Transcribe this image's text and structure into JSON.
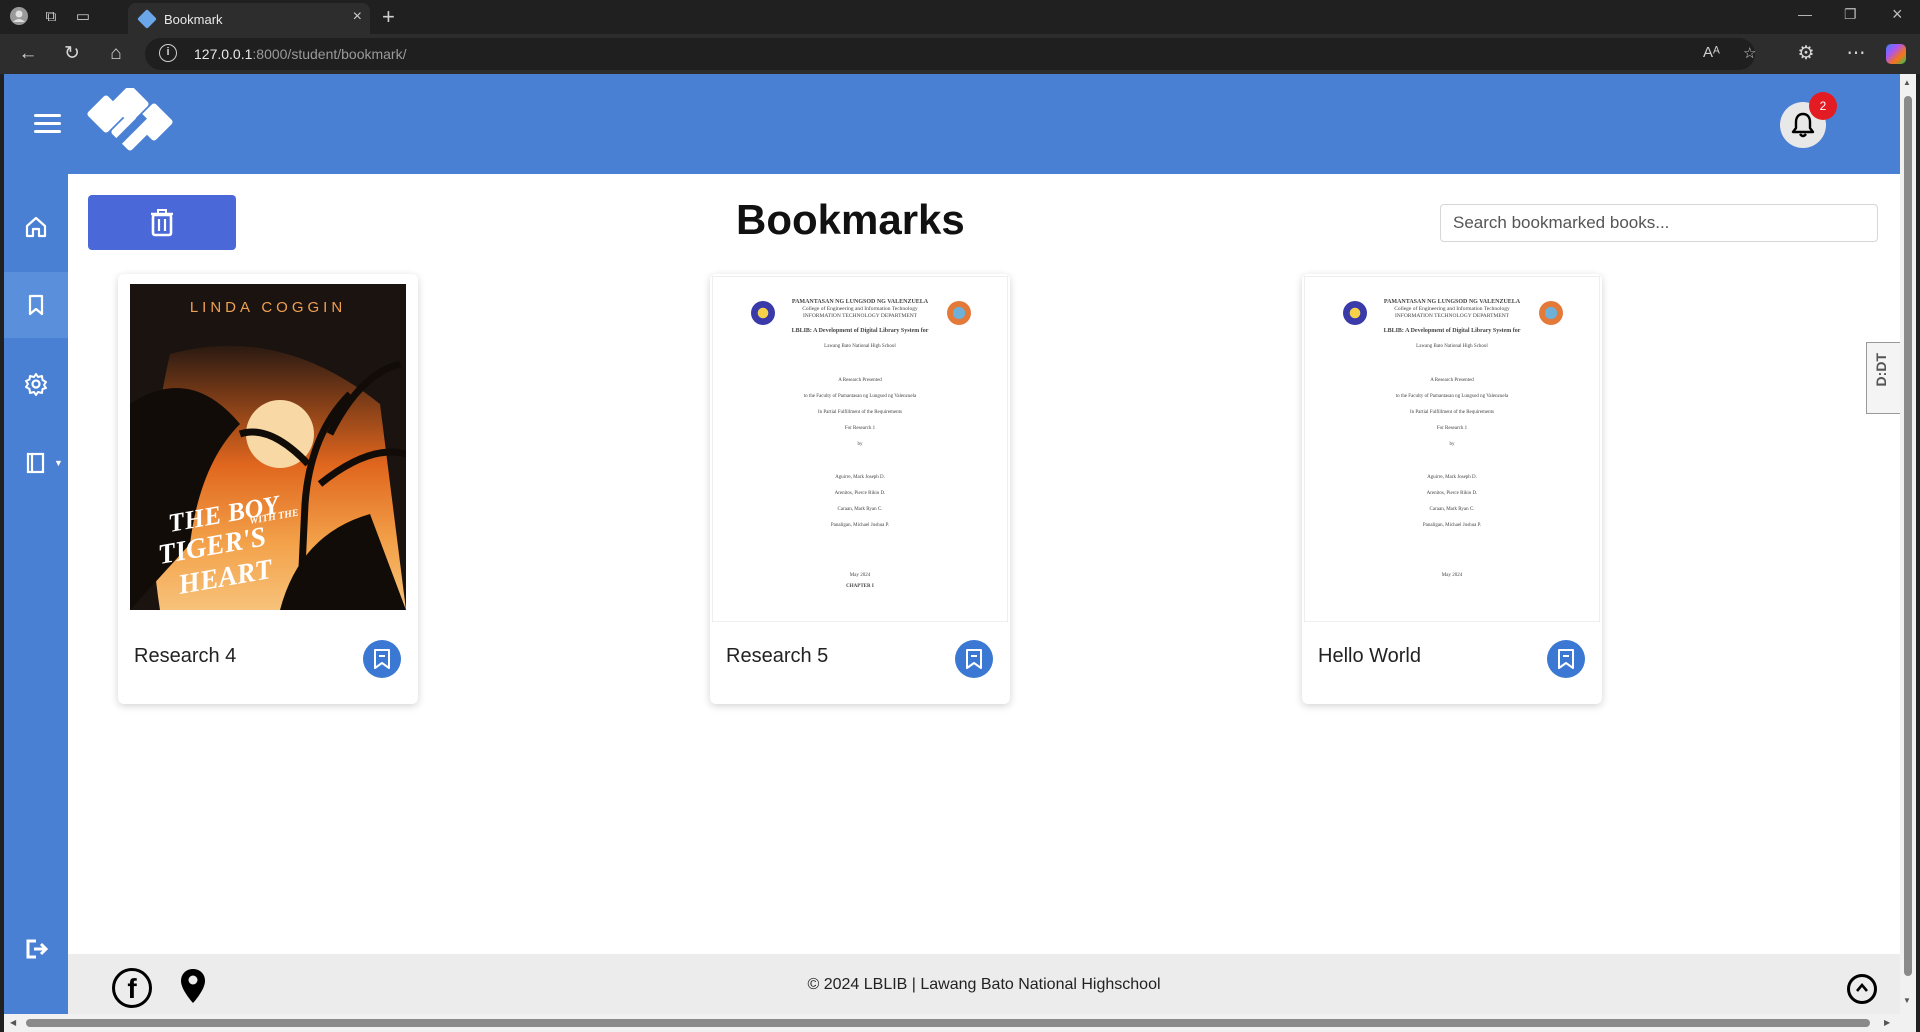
{
  "browser": {
    "tab_title": "Bookmark",
    "url_host": "127.0.0.1",
    "url_path": ":8000/student/bookmark/"
  },
  "header": {
    "notification_count": "2"
  },
  "page": {
    "title": "Bookmarks",
    "search_placeholder": "Search bookmarked books..."
  },
  "cards": [
    {
      "label": "Research 4",
      "cover_author": "LINDA COGGIN",
      "cover_title_lines": [
        "THE BOY",
        "WITH THE",
        "TIGER'S",
        "HEART"
      ]
    },
    {
      "label": "Research 5",
      "doc": {
        "header1": "PAMANTASAN NG LUNGSOD NG VALENZUELA",
        "header2": "College of Engineering and Information Technology",
        "header3": "INFORMATION TECHNOLOGY DEPARTMENT",
        "title": "LBLIB: A Development of Digital Library System for",
        "school": "Lawang Bato National High School",
        "lines": [
          "A Research Presented",
          "to the Faculty of Pamantasan ng Lungsod ng Valenzuela",
          "In Partial Fulfillment of the Requirements",
          "For Research 1",
          "by"
        ],
        "authors": [
          "Aguirre, Mark Joseph D.",
          "Arenitos, Pierce Rikio D.",
          "Caraan, Mark Ryan C.",
          "Panaligan, Michael Joshua P."
        ],
        "date": "May 2024",
        "chapter": "CHAPTER I"
      }
    },
    {
      "label": "Hello World",
      "doc": {
        "header1": "PAMANTASAN NG LUNGSOD NG VALENZUELA",
        "header2": "College of Engineering and Information Technology",
        "header3": "INFORMATION TECHNOLOGY DEPARTMENT",
        "title": "LBLIB: A Development of Digital Library System for",
        "school": "Lawang Bato National High School",
        "lines": [
          "A Research Presented",
          "to the Faculty of Pamantasan ng Lungsod ng Valenzuela",
          "In Partial Fulfillment of the Requirements",
          "For Research 1",
          "by"
        ],
        "authors": [
          "Aguirre, Mark Joseph D.",
          "Arenitos, Pierce Rikio D.",
          "Caraan, Mark Ryan C.",
          "Panaligan, Michael Joshua P."
        ],
        "date": "May 2024"
      }
    }
  ],
  "footer": {
    "text": "© 2024 LBLIB | Lawang Bato National Highschool",
    "facebook_glyph": "f"
  },
  "extension_badge": "D:DT",
  "colors": {
    "primary": "#4a80d4",
    "delete_button": "#4a68d8",
    "badge": "#e31b23"
  },
  "icons": [
    "hamburger-icon",
    "bell-icon",
    "home-icon",
    "bookmark-icon",
    "gear-icon",
    "book-icon",
    "logout-icon",
    "trash-icon",
    "bookmark-remove-icon",
    "facebook-icon",
    "map-pin-icon",
    "arrow-up-icon"
  ]
}
